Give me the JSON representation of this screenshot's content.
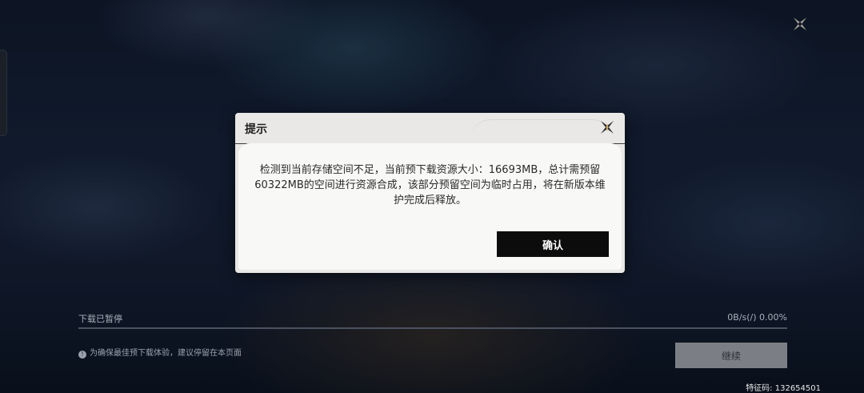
{
  "background": {
    "close_icon": "close-x-icon"
  },
  "download": {
    "status": "下载已暂停",
    "speed": "0B/s(/) 0.00%",
    "progress": 0,
    "note": "为确保最佳预下载体验，建议停留在本页面",
    "continue_label": "继续"
  },
  "feature_code": "特征码: 132654501",
  "dialog": {
    "title": "提示",
    "message": "检测到当前存储空间不足，当前预下载资源大小：16693MB，总计需预留60322MB的空间进行资源合成，该部分预留空间为临时占用，将在新版本维护完成后释放。",
    "confirm_label": "确认",
    "close_icon": "close-x-icon"
  },
  "colors": {
    "dialog_bg": "#f8f8f7",
    "confirm_bg": "#0c0c0c",
    "continue_bg": "#7b7e84"
  }
}
